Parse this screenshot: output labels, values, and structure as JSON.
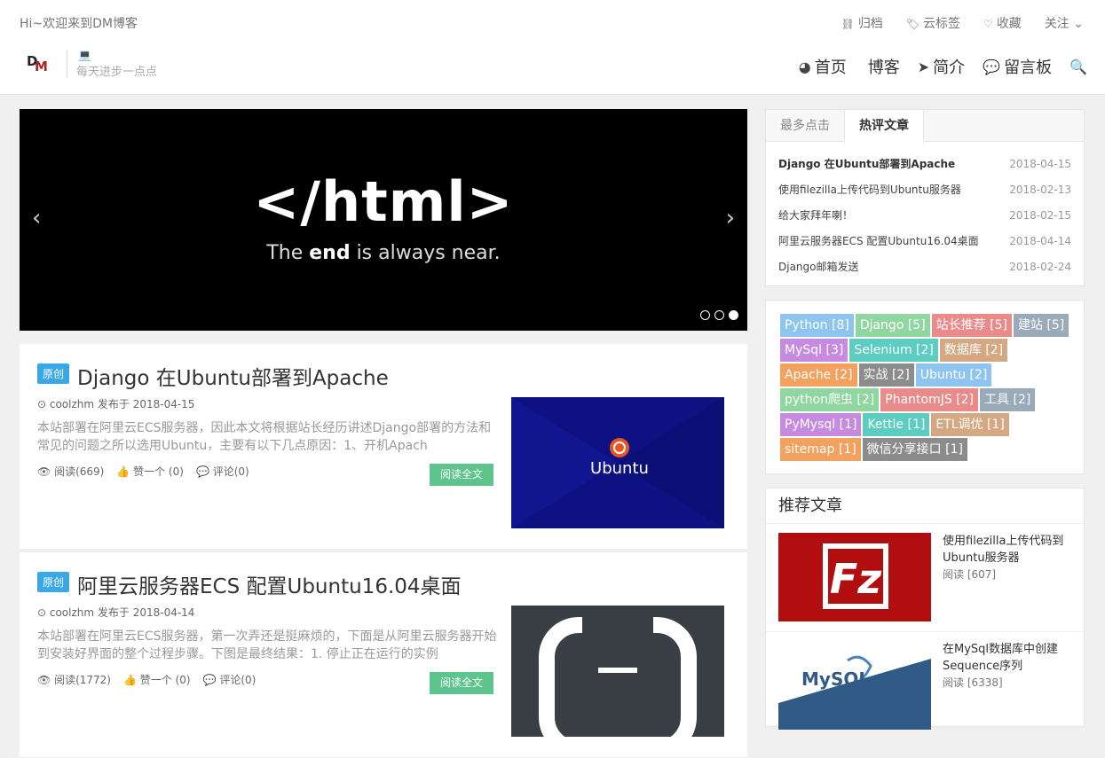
{
  "header": {
    "welcome": "Hi~欢迎来到DM博客",
    "top_links": [
      {
        "icon": "sitemap-icon",
        "glyph": "⛓",
        "label": "归档"
      },
      {
        "icon": "tags-icon",
        "glyph": "🏷",
        "label": "云标签"
      },
      {
        "icon": "heart-icon",
        "glyph": "♡",
        "label": "收藏"
      },
      {
        "icon": "chevron-down-icon",
        "glyph": "",
        "label": "关注 ⌄"
      }
    ],
    "slogan": "每天进步一点点",
    "nav": [
      {
        "icon": "home-icon",
        "glyph": "◕",
        "label": "首页"
      },
      {
        "icon": "apple-icon",
        "glyph": "",
        "label": "博客"
      },
      {
        "icon": "paper-plane-icon",
        "glyph": "➤",
        "label": "简介"
      },
      {
        "icon": "comments-icon",
        "glyph": "💬",
        "label": "留言板"
      }
    ],
    "search_glyph": "🔍"
  },
  "slider": {
    "title": "</html>",
    "sub_before": "The ",
    "sub_bold": "end",
    "sub_after": " is always near.",
    "prev": "‹",
    "next": "›",
    "active_dot": 3
  },
  "posts": [
    {
      "badge": "原创",
      "title": "Django 在Ubuntu部署到Apache",
      "meta": "⊙ coolzhm 发布于 2018-04-15",
      "excerpt": "本站部署在阿里云ECS服务器，因此本文将根据站长经历讲述Django部署的方法和常见的问题之所以选用Ubuntu，主要有以下几点原因：1、开机Apach",
      "views": "阅读(669)",
      "likes": "赞一个 (0)",
      "comments": "评论(0)",
      "read_more": "阅读全文",
      "thumb_text": "Ubuntu"
    },
    {
      "badge": "原创",
      "title": "阿里云服务器ECS 配置Ubuntu16.04桌面",
      "meta": "⊙ coolzhm 发布于 2018-04-14",
      "excerpt": "本站部署在阿里云ECS服务器，第一次弄还是挺麻烦的，下面是从阿里云服务器开始到安装好界面的整个过程步骤。下图是最终结果：1. 停止正在运行的实例",
      "views": "阅读(1772)",
      "likes": "赞一个 (0)",
      "comments": "评论(0)",
      "read_more": "阅读全文"
    }
  ],
  "hot_panel": {
    "tabs": [
      "最多点击",
      "热评文章"
    ],
    "active_tab": 1,
    "items": [
      {
        "title": "Django 在Ubuntu部署到Apache",
        "date": "2018-04-15"
      },
      {
        "title": "使用filezilla上传代码到Ubuntu服务器",
        "date": "2018-02-13"
      },
      {
        "title": "给大家拜年喇！",
        "date": "2018-02-15"
      },
      {
        "title": "阿里云服务器ECS 配置Ubuntu16.04桌面",
        "date": "2018-04-14"
      },
      {
        "title": "Django邮箱发送",
        "date": "2018-02-24"
      }
    ]
  },
  "tags": [
    {
      "label": "Python [8]",
      "color": "#8ec5f0"
    },
    {
      "label": "Django [5]",
      "color": "#8fd6a0"
    },
    {
      "label": "站长推荐 [5]",
      "color": "#e98b8b"
    },
    {
      "label": "建站 [5]",
      "color": "#9aaab8"
    },
    {
      "label": "MySql [3]",
      "color": "#c68be0"
    },
    {
      "label": "Selenium [2]",
      "color": "#5ccdc0"
    },
    {
      "label": "数据库 [2]",
      "color": "#d4a882"
    },
    {
      "label": "Apache [2]",
      "color": "#f3a15f"
    },
    {
      "label": "实战 [2]",
      "color": "#8c8c8c"
    },
    {
      "label": "Ubuntu [2]",
      "color": "#8ec5f0"
    },
    {
      "label": "python爬虫 [2]",
      "color": "#8fd6a0"
    },
    {
      "label": "PhantomJS [2]",
      "color": "#e98b8b"
    },
    {
      "label": "工具 [2]",
      "color": "#9aaab8"
    },
    {
      "label": "PyMysql [1]",
      "color": "#c68be0"
    },
    {
      "label": "Kettle [1]",
      "color": "#5ccdc0"
    },
    {
      "label": "ETL调优 [1]",
      "color": "#d4a882"
    },
    {
      "label": "sitemap [1]",
      "color": "#f3a15f"
    },
    {
      "label": "微信分享接口 [1]",
      "color": "#8c8c8c"
    }
  ],
  "recommend": {
    "heading": "推荐文章",
    "items": [
      {
        "title": "使用filezilla上传代码到Ubuntu服务器",
        "views": "阅读 [607]"
      },
      {
        "title": "在MySql数据库中创建Sequence序列",
        "views": "阅读 [6338]",
        "logo_text": "MySQL"
      }
    ]
  }
}
